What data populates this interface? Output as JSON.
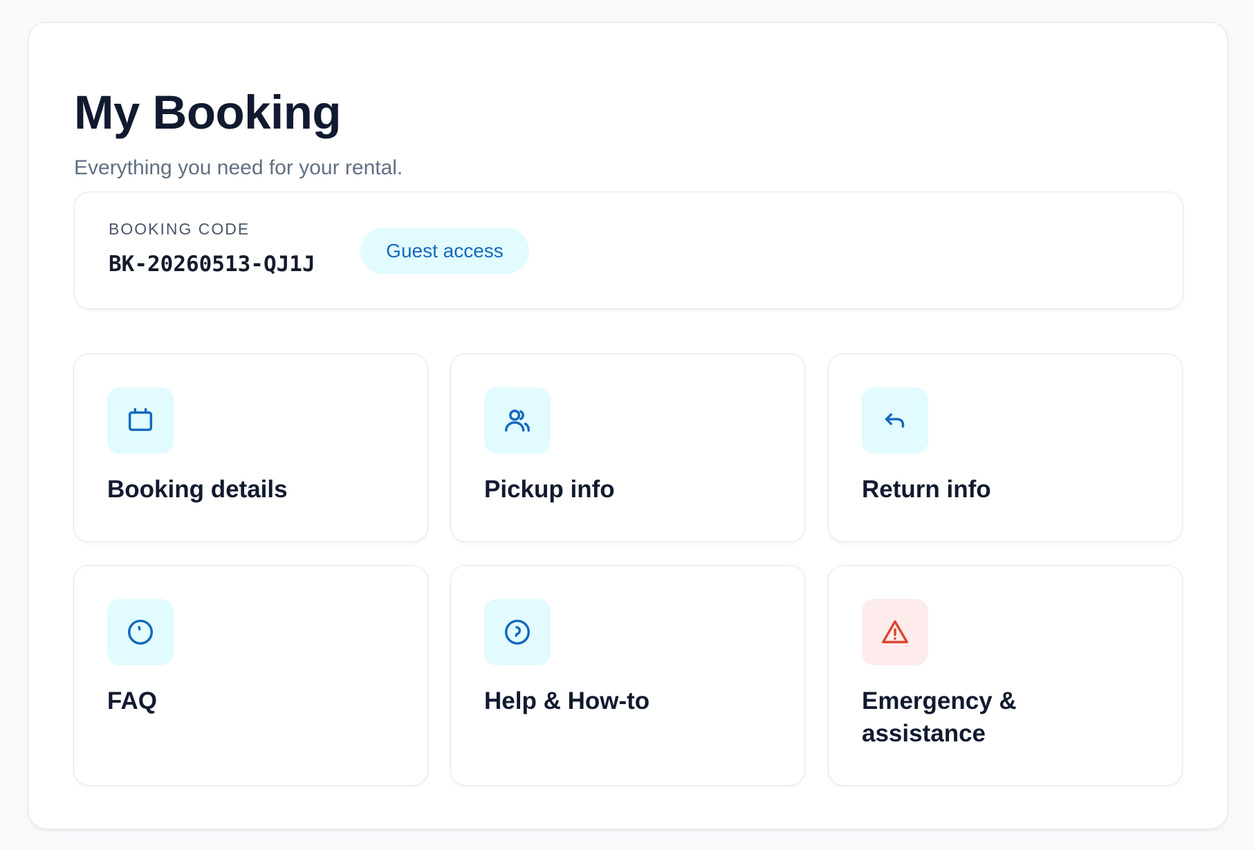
{
  "header": {
    "title": "My Booking",
    "subtitle": "Everything you need for your rental."
  },
  "booking": {
    "code_label": "BOOKING CODE",
    "code": "BK-20260513-QJ1J",
    "access_badge": "Guest access"
  },
  "tiles": [
    {
      "label": "Booking details",
      "icon": "calendar-icon"
    },
    {
      "label": "Pickup info",
      "icon": "users-icon"
    },
    {
      "label": "Return info",
      "icon": "return-arrow-icon"
    },
    {
      "label": "FAQ",
      "icon": "help-circle-icon"
    },
    {
      "label": "Help & How-to",
      "icon": "help-circle-icon"
    },
    {
      "label": "Emergency & assistance",
      "icon": "warning-triangle-icon"
    }
  ],
  "colors": {
    "accent": "#1468bd",
    "icon_bg": "#e1fbff",
    "danger": "#d9472f",
    "danger_bg": "#fdeceb",
    "text": "#111a2f",
    "muted": "#5f6f84"
  }
}
